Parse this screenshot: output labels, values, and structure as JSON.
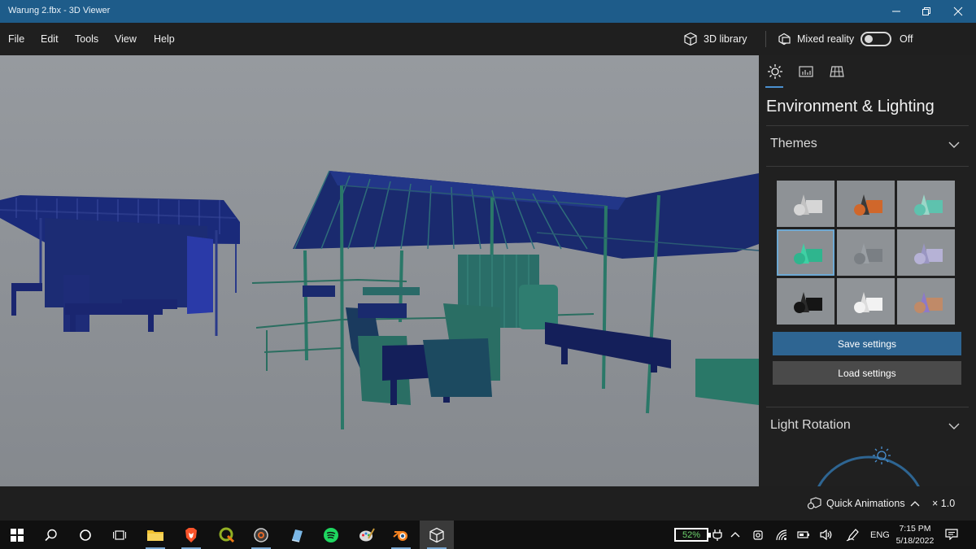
{
  "window": {
    "title": "Warung 2.fbx - 3D Viewer"
  },
  "menu": {
    "items": [
      "File",
      "Edit",
      "Tools",
      "View",
      "Help"
    ],
    "library_label": "3D library",
    "mixed_reality_label": "Mixed reality",
    "mixed_reality_state": "Off"
  },
  "panel": {
    "tabs": [
      "sun-icon",
      "stats-icon",
      "grid-icon"
    ],
    "title": "Environment & Lighting",
    "themes_label": "Themes",
    "themes": [
      {
        "name": "theme-light",
        "bg": "#8e9296",
        "c1": "#d6d6d6",
        "c2": "#c2c2c2"
      },
      {
        "name": "theme-warm",
        "bg": "#8a8e92",
        "c1": "#d0672b",
        "c2": "#3a3a3a"
      },
      {
        "name": "theme-teal",
        "bg": "#909498",
        "c1": "#5ec2ae",
        "c2": "#9ad7c8"
      },
      {
        "name": "theme-green",
        "bg": "#8a8e92",
        "c1": "#2fb58e",
        "c2": "#3fd0a4",
        "selected": true
      },
      {
        "name": "theme-gray",
        "bg": "#8e9296",
        "c1": "#7a7f84",
        "c2": "#9a9fa4"
      },
      {
        "name": "theme-violet",
        "bg": "#8e9296",
        "c1": "#b6b2d6",
        "c2": "#9a96c2"
      },
      {
        "name": "theme-dark",
        "bg": "#8c9094",
        "c1": "#151515",
        "c2": "#2a2a2a"
      },
      {
        "name": "theme-white",
        "bg": "#909498",
        "c1": "#f2f2f2",
        "c2": "#dcdcdc"
      },
      {
        "name": "theme-sunset",
        "bg": "#8e9296",
        "c1": "#c08a68",
        "c2": "#8d7ac8"
      }
    ],
    "save_label": "Save settings",
    "load_label": "Load settings",
    "light_rotation_label": "Light Rotation"
  },
  "status": {
    "quick_animations_label": "Quick Animations",
    "speed": "× 1.0"
  },
  "taskbar": {
    "battery": "52%",
    "language": "ENG",
    "time": "7:15 PM",
    "date": "5/18/2022"
  },
  "colors": {
    "accent": "#2e6592",
    "titlebar": "#1e5c8a",
    "viewport_bg": "#8d9196",
    "model_blue": "#1a2a6e",
    "model_teal": "#2f8a78"
  }
}
